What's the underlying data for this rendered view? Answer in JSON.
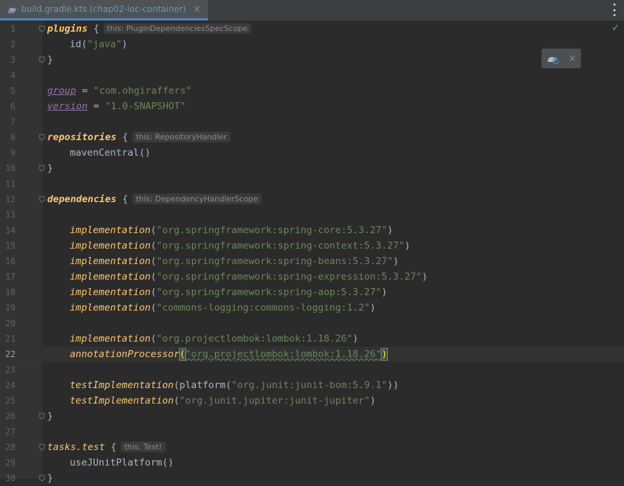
{
  "tab": {
    "icon": "gradle-kotlin-icon",
    "label": "build.gradle.kts (chap02-ioc-container)",
    "close": "×"
  },
  "editor": {
    "current_line": 22,
    "status_check": "✓",
    "gradle_popup": {
      "icon": "gradle-sync-icon",
      "close": "×"
    },
    "lines": [
      {
        "n": "1"
      },
      {
        "n": "2"
      },
      {
        "n": "3"
      },
      {
        "n": "4"
      },
      {
        "n": "5"
      },
      {
        "n": "6"
      },
      {
        "n": "7"
      },
      {
        "n": "8"
      },
      {
        "n": "9"
      },
      {
        "n": "10"
      },
      {
        "n": "11"
      },
      {
        "n": "12"
      },
      {
        "n": "13"
      },
      {
        "n": "14"
      },
      {
        "n": "15"
      },
      {
        "n": "16"
      },
      {
        "n": "17"
      },
      {
        "n": "18"
      },
      {
        "n": "19"
      },
      {
        "n": "20"
      },
      {
        "n": "21"
      },
      {
        "n": "22"
      },
      {
        "n": "23"
      },
      {
        "n": "24"
      },
      {
        "n": "25"
      },
      {
        "n": "26"
      },
      {
        "n": "27"
      },
      {
        "n": "28"
      },
      {
        "n": "29"
      },
      {
        "n": "30"
      }
    ],
    "code": {
      "l1": {
        "kw": "plugins",
        "rest": " {",
        "hint": "this: PluginDependenciesSpecScope"
      },
      "l2": {
        "pre": "id(",
        "str": "\"java\"",
        "post": ")"
      },
      "l3": {
        "text": "}"
      },
      "l5": {
        "prop": "group",
        "eq": " = ",
        "str": "\"com.ohgiraffers\""
      },
      "l6": {
        "prop": "version",
        "eq": " = ",
        "str": "\"1.0-SNAPSHOT\""
      },
      "l8": {
        "kw": "repositories",
        "rest": " {",
        "hint": "this: RepositoryHandler"
      },
      "l9": {
        "text": "mavenCentral()"
      },
      "l10": {
        "text": "}"
      },
      "l12": {
        "kw": "dependencies",
        "rest": " {",
        "hint": "this: DependencyHandlerScope"
      },
      "l14": {
        "fn": "implementation",
        "str": "\"org.springframework:spring-core:5.3.27\""
      },
      "l15": {
        "fn": "implementation",
        "str": "\"org.springframework:spring-context:5.3.27\""
      },
      "l16": {
        "fn": "implementation",
        "str": "\"org.springframework:spring-beans:5.3.27\""
      },
      "l17": {
        "fn": "implementation",
        "str": "\"org.springframework:spring-expression:5.3.27\""
      },
      "l18": {
        "fn": "implementation",
        "str": "\"org.springframework:spring-aop:5.3.27\""
      },
      "l19": {
        "fn": "implementation",
        "str": "\"commons-logging:commons-logging:1.2\""
      },
      "l21": {
        "fn": "implementation",
        "str": "\"org.projectlombok:lombok:1.18.26\""
      },
      "l22": {
        "fn": "annotationProcessor",
        "str": "\"org.projectlombok:lombok:1.18.26\""
      },
      "l24": {
        "fn": "testImplementation",
        "mid": "(platform(",
        "str": "\"org.junit:junit-bom:5.9.1\"",
        "post": "))"
      },
      "l25": {
        "fn": "testImplementation",
        "str": "\"org.junit.jupiter:junit-jupiter\""
      },
      "l26": {
        "text": "}"
      },
      "l28": {
        "kw": "tasks.test",
        "rest": " {",
        "hint": "this: Test!"
      },
      "l29": {
        "text": "useJUnitPlatform()"
      },
      "l30": {
        "text": "}"
      }
    }
  }
}
